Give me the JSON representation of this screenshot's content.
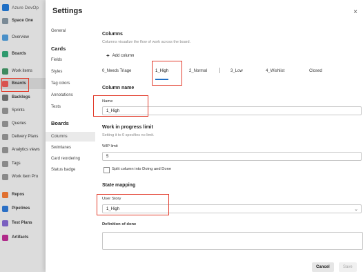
{
  "nav": {
    "title": "Azure DevOp",
    "items": [
      {
        "label": "Space One",
        "color": "#7a8a96",
        "bold": true
      },
      {
        "label": "Overview",
        "color": "#4a90c8",
        "bold": false
      },
      {
        "label": "Boards",
        "color": "#2e9a6e",
        "bold": true
      },
      {
        "label": "Work items",
        "color": "#3d8a5f",
        "bold": false
      },
      {
        "label": "Boards",
        "color": "#d9534f",
        "bold": true,
        "selected": true
      },
      {
        "label": "Backlogs",
        "color": "#6b6b6b",
        "bold": true
      },
      {
        "label": "Sprints",
        "color": "#8a8a8a",
        "bold": false
      },
      {
        "label": "Queries",
        "color": "#8a8a8a",
        "bold": false
      },
      {
        "label": "Delivery Plans",
        "color": "#8a8a8a",
        "bold": false
      },
      {
        "label": "Analytics views",
        "color": "#8a8a8a",
        "bold": false
      },
      {
        "label": "Tags",
        "color": "#8a8a8a",
        "bold": false
      },
      {
        "label": "Work Item Pro",
        "color": "#8a8a8a",
        "bold": false
      },
      {
        "label": "Repos",
        "color": "#e07030",
        "bold": true
      },
      {
        "label": "Pipelines",
        "color": "#2a6fc5",
        "bold": true
      },
      {
        "label": "Test Plans",
        "color": "#7a5fc0",
        "bold": true
      },
      {
        "label": "Artifacts",
        "color": "#b02a8a",
        "bold": true
      }
    ]
  },
  "modal": {
    "title": "Settings",
    "close": "×",
    "sidebar": {
      "general": "General",
      "cards_header": "Cards",
      "cards_items": [
        "Fields",
        "Styles",
        "Tag colors",
        "Annotations",
        "Tests"
      ],
      "boards_header": "Boards",
      "boards_items": [
        "Columns",
        "Swimlanes",
        "Card reordering",
        "Status badge"
      ]
    },
    "columns_title": "Columns",
    "columns_subtitle": "Columns visualize the flow of work across the board.",
    "add_column": "Add column",
    "tabs": [
      "0_Needs Triage",
      "1_High",
      "2_Normal",
      "3_Low",
      "4_Wishlist",
      "Closed"
    ],
    "active_tab": "1_High",
    "column_name_title": "Column name",
    "name_label": "Name",
    "name_value": "1_High",
    "wip_title": "Work in progress limit",
    "wip_subtitle": "Setting it to 0 specifies no limit.",
    "wip_label": "WIP limit",
    "wip_value": "5",
    "split_label": "Split column into Doing and Done",
    "state_mapping_title": "State mapping",
    "user_story_label": "User Story",
    "user_story_value": "1_High",
    "dod_label": "Definition of done",
    "cancel": "Cancel",
    "save": "Save"
  }
}
